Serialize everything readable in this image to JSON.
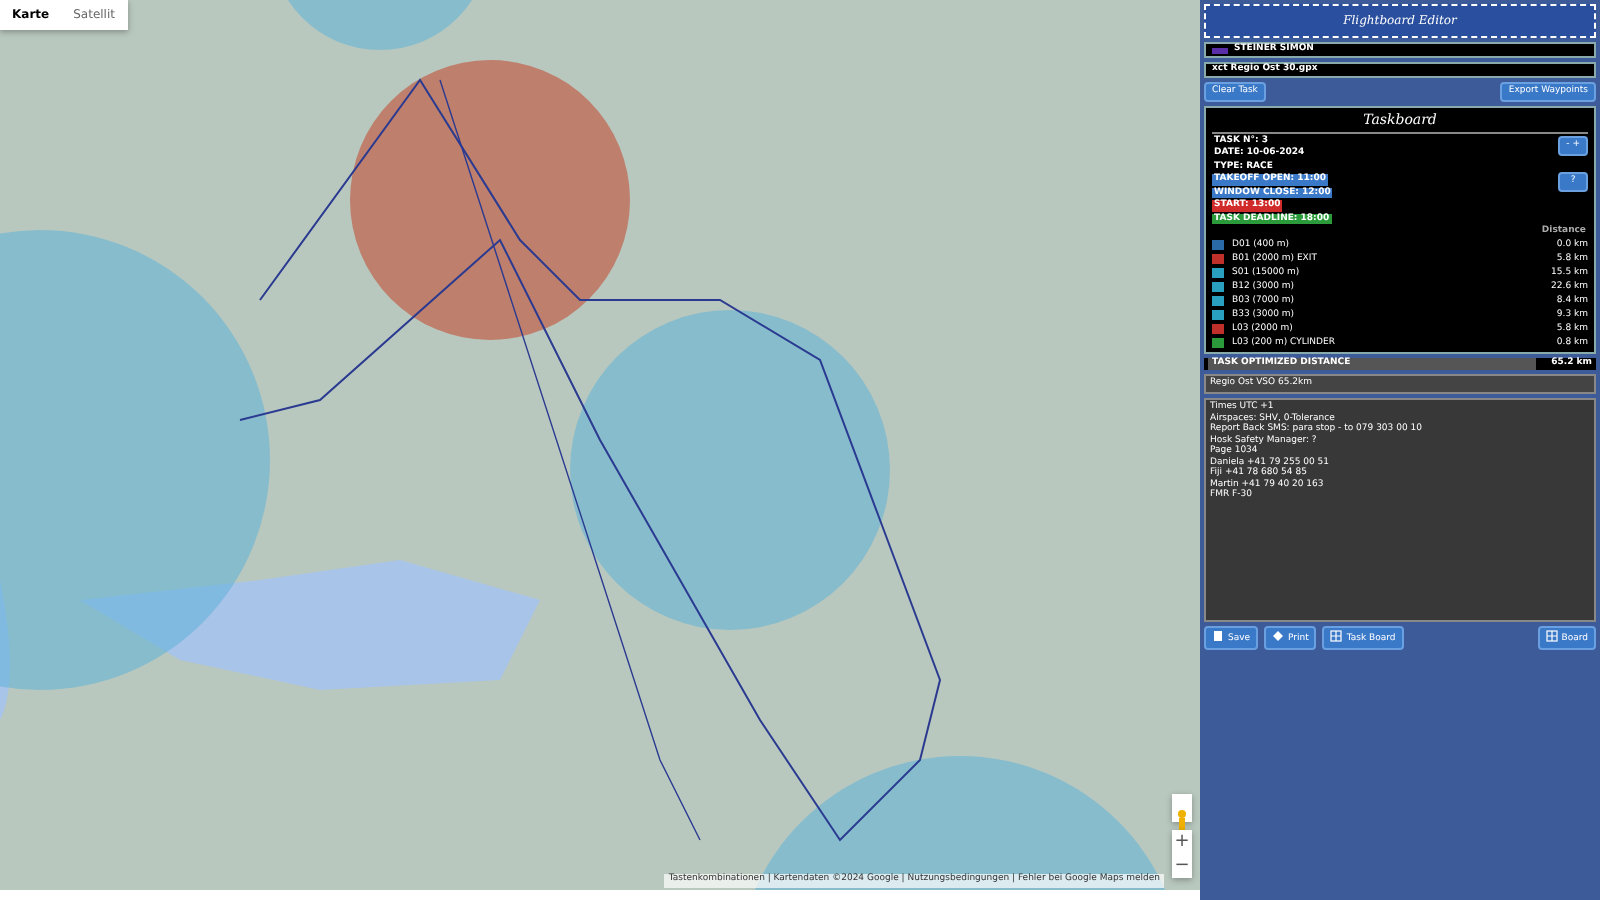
{
  "map": {
    "map_types": [
      {
        "label": "Karte",
        "selected": true
      },
      {
        "label": "Satellit",
        "selected": false
      }
    ],
    "attribution": "Tastenkombinationen | Kartendaten ©2024 Google | Nutzungsbedingungen | Fehler bei Google Maps melden",
    "zoom_in": "+",
    "zoom_out": "−"
  },
  "panel": {
    "title": "Flightboard Editor",
    "pilot_select": {
      "value": "STEINER SIMON",
      "color": "#5a2ea6"
    },
    "file_select": {
      "value": "xct Regio Ost 30.gpx"
    },
    "toolbar": [
      "Clear Task",
      "Export Waypoints"
    ],
    "taskboard": {
      "title": "Taskboard",
      "lines": [
        {
          "text": "TASK N°: 3",
          "kind": "plain"
        },
        {
          "text": "DATE: 10-06-2024",
          "kind": "plain"
        },
        {
          "text": "TYPE: RACE",
          "kind": "plain"
        },
        {
          "text": "TAKEOFF OPEN: 11:00",
          "kind": "info"
        },
        {
          "text": "WINDOW CLOSE: 12:00",
          "kind": "info"
        },
        {
          "text": "START: 13:00",
          "kind": "start"
        },
        {
          "text": "TASK DEADLINE: 18:00",
          "kind": "deadline"
        }
      ],
      "side_buttons": [
        "- +",
        "?"
      ],
      "distance_header": "Distance",
      "turnpoints": [
        {
          "name": "D01 (400 m)",
          "distance": "0.0 km",
          "color": "#2a6aa8"
        },
        {
          "name": "B01 (2000 m) EXIT",
          "distance": "5.8 km",
          "color": "#c0302a"
        },
        {
          "name": "S01 (15000 m)",
          "distance": "15.5 km",
          "color": "#2aa0c0"
        },
        {
          "name": "B12 (3000 m)",
          "distance": "22.6 km",
          "color": "#2aa0c0"
        },
        {
          "name": "B03 (7000 m)",
          "distance": "8.4 km",
          "color": "#2aa0c0"
        },
        {
          "name": "B33 (3000 m)",
          "distance": "9.3 km",
          "color": "#2aa0c0"
        },
        {
          "name": "L03 (2000 m)",
          "distance": "5.8 km",
          "color": "#c0302a"
        },
        {
          "name": "L03 (200 m) CYLINDER",
          "distance": "0.8 km",
          "color": "#2a9a3a"
        }
      ],
      "optimized_label": "TASK OPTIMIZED DISTANCE",
      "optimized_value": "65.2 km"
    },
    "task_name": "Regio Ost VSO 65.2km",
    "notes": [
      "Times UTC +1",
      "Airspaces: SHV, 0-Tolerance",
      "Report Back SMS: para stop - to 079 303 00 10",
      "Hosk Safety Manager: ?",
      "Page 1034",
      "Daniela +41 79 255 00 51",
      "Fiji +41 78 680 54 85",
      "Martin +41 79 40 20 163",
      "FMR F-30"
    ],
    "footer_buttons": [
      {
        "label": "Save",
        "kind": "save"
      },
      {
        "label": "Print",
        "kind": "print"
      },
      {
        "label": "Task Board",
        "kind": "board"
      }
    ],
    "board_button": "Board"
  }
}
